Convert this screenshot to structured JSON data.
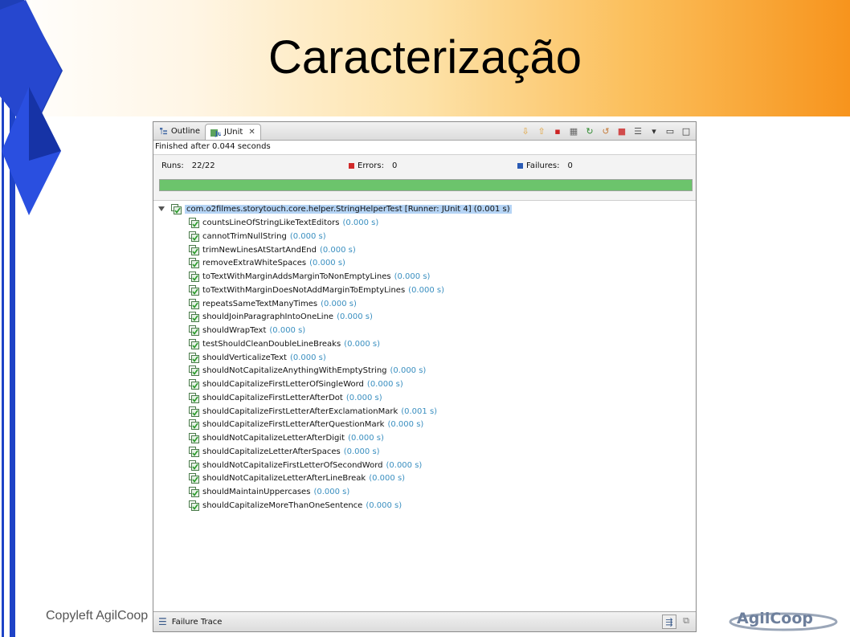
{
  "slide": {
    "title": "Caracterização",
    "footer": "Copyleft AgilCoop",
    "logo_text": "AgilCoop",
    "colors": {
      "header_start": "#ffffff",
      "header_end": "#f7941d",
      "diamond": "#1e43c7"
    }
  },
  "window": {
    "tabs": [
      {
        "label": "Outline",
        "icon": "outline-icon"
      },
      {
        "label": "JUnit",
        "icon": "junit-icon"
      }
    ],
    "toolbar_icons": [
      "next-failure-icon",
      "previous-failure-icon",
      "show-failures-only-icon",
      "scroll-lock-icon",
      "rerun-icon",
      "rerun-failed-icon",
      "stop-icon",
      "history-icon",
      "view-menu-icon",
      "minimize-icon",
      "maximize-icon"
    ],
    "status": "Finished after 0.044 seconds",
    "counters": {
      "runs_label": "Runs:",
      "runs_value": "22/22",
      "errors_label": "Errors:",
      "errors_value": "0",
      "failures_label": "Failures:",
      "failures_value": "0"
    },
    "progress": {
      "fraction": 1.0,
      "color": "#6cc46c"
    },
    "root": {
      "label": "com.o2filmes.storytouch.core.helper.StringHelperTest [Runner: JUnit 4] (0.001 s)"
    },
    "tests": [
      {
        "name": "countsLineOfStringLikeTextEditors",
        "time": "(0.000 s)"
      },
      {
        "name": "cannotTrimNullString",
        "time": "(0.000 s)"
      },
      {
        "name": "trimNewLinesAtStartAndEnd",
        "time": "(0.000 s)"
      },
      {
        "name": "removeExtraWhiteSpaces",
        "time": "(0.000 s)"
      },
      {
        "name": "toTextWithMarginAddsMarginToNonEmptyLines",
        "time": "(0.000 s)"
      },
      {
        "name": "toTextWithMarginDoesNotAddMarginToEmptyLines",
        "time": "(0.000 s)"
      },
      {
        "name": "repeatsSameTextManyTimes",
        "time": "(0.000 s)"
      },
      {
        "name": "shouldJoinParagraphIntoOneLine",
        "time": "(0.000 s)"
      },
      {
        "name": "shouldWrapText",
        "time": "(0.000 s)"
      },
      {
        "name": "testShouldCleanDoubleLineBreaks",
        "time": "(0.000 s)"
      },
      {
        "name": "shouldVerticalizeText",
        "time": "(0.000 s)"
      },
      {
        "name": "shouldNotCapitalizeAnythingWithEmptyString",
        "time": "(0.000 s)"
      },
      {
        "name": "shouldCapitalizeFirstLetterOfSingleWord",
        "time": "(0.000 s)"
      },
      {
        "name": "shouldCapitalizeFirstLetterAfterDot",
        "time": "(0.000 s)"
      },
      {
        "name": "shouldCapitalizeFirstLetterAfterExclamationMark",
        "time": "(0.001 s)"
      },
      {
        "name": "shouldCapitalizeFirstLetterAfterQuestionMark",
        "time": "(0.000 s)"
      },
      {
        "name": "shouldNotCapitalizeLetterAfterDigit",
        "time": "(0.000 s)"
      },
      {
        "name": "shouldCapitalizeLetterAfterSpaces",
        "time": "(0.000 s)"
      },
      {
        "name": "shouldNotCapitalizeFirstLetterOfSecondWord",
        "time": "(0.000 s)"
      },
      {
        "name": "shouldNotCapitalizeLetterAfterLineBreak",
        "time": "(0.000 s)"
      },
      {
        "name": "shouldMaintainUppercases",
        "time": "(0.000 s)"
      },
      {
        "name": "shouldCapitalizeMoreThanOneSentence",
        "time": "(0.000 s)"
      }
    ],
    "failure_trace": {
      "label": "Failure Trace"
    }
  }
}
